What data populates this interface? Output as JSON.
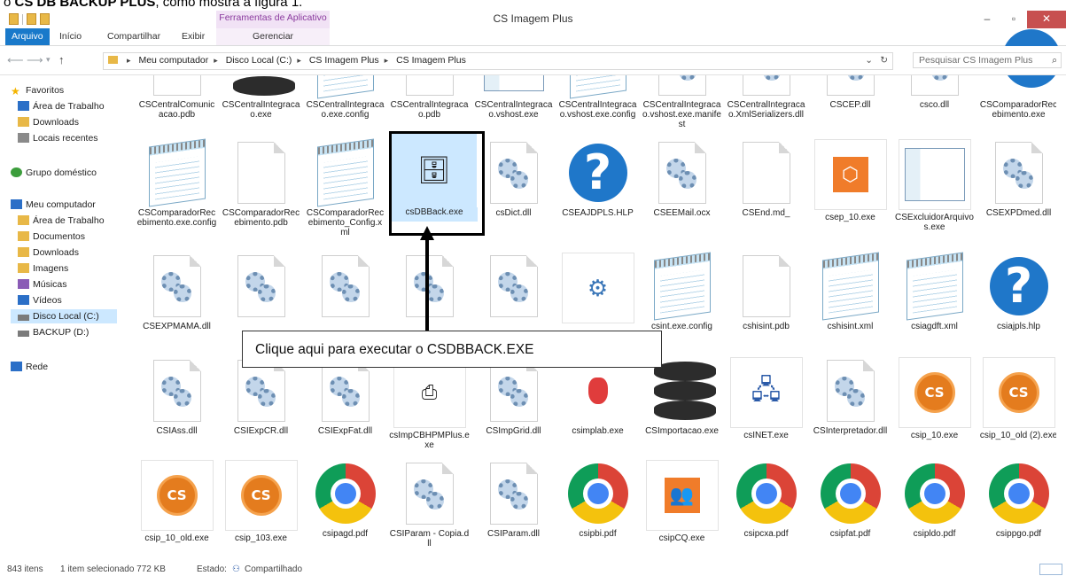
{
  "doc_text": {
    "prefix": "o ",
    "bold": "CS DB BACKUP PLUS",
    "suffix": ", como mostra a figura 1."
  },
  "window": {
    "title": "CS Imagem Plus",
    "contextual_tab": "Ferramentas de Aplicativo"
  },
  "ribbon": {
    "tabs": [
      "Arquivo",
      "Início",
      "Compartilhar",
      "Exibir",
      "Gerenciar"
    ]
  },
  "address": {
    "crumbs": [
      "Meu computador",
      "Disco Local (C:)",
      "CS Imagem Plus",
      "CS Imagem Plus"
    ],
    "search_placeholder": "Pesquisar CS Imagem Plus"
  },
  "sidebar": {
    "favorites": [
      "Favoritos",
      "Área de Trabalho",
      "Downloads",
      "Locais recentes"
    ],
    "homegroup": "Grupo doméstico",
    "computer": [
      "Meu computador",
      "Área de Trabalho",
      "Documentos",
      "Downloads",
      "Imagens",
      "Músicas",
      "Vídeos",
      "Disco Local (C:)",
      "BACKUP (D:)"
    ],
    "network": "Rede"
  },
  "files": {
    "row1": [
      "CSCentralComunicacao.pdb",
      "CSCentralIntegracao.exe",
      "CSCentralIntegracao.exe.config",
      "CSCentralIntegracao.pdb",
      "CSCentralIntegracao.vshost.exe",
      "CSCentralIntegracao.vshost.exe.config",
      "CSCentralIntegracao.vshost.exe.manifest",
      "CSCentralIntegracao.XmlSerializers.dll",
      "CSCEP.dll",
      "csco.dll",
      "CSComparadorRecebimento.exe"
    ],
    "row2": [
      "CSComparadorRecebimento.exe.config",
      "CSComparadorRecebimento.pdb",
      "CSComparadorRecebimento_Config.xml",
      "csDBBack.exe",
      "csDict.dll",
      "CSEAJDPLS.HLP",
      "CSEEMail.ocx",
      "CSEnd.md_",
      "csep_10.exe",
      "CSExcluidorArquivos.exe",
      "CSEXPDmed.dll"
    ],
    "row3": [
      "CSEXPMAMA.dll",
      "",
      "",
      "",
      "",
      "",
      "csint.exe.config",
      "cshisint.pdb",
      "cshisint.xml",
      "csiagdft.xml",
      "csiajpls.hlp"
    ],
    "row4": [
      "CSIAss.dll",
      "CSIExpCR.dll",
      "CSIExpFat.dll",
      "csImpCBHPMPlus.exe",
      "CSImpGrid.dll",
      "csimplab.exe",
      "CSImportacao.exe",
      "csINET.exe",
      "CSInterpretador.dll",
      "csip_10.exe",
      "csip_10_old (2).exe"
    ],
    "row5": [
      "csip_10_old.exe",
      "csip_103.exe",
      "csipagd.pdf",
      "CSIParam - Copia.dll",
      "CSIParam.dll",
      "csipbi.pdf",
      "csipCQ.exe",
      "csipcxa.pdf",
      "csipfat.pdf",
      "csipldo.pdf",
      "csippgo.pdf"
    ]
  },
  "callout": "Clique aqui para executar o CSDBBACK.EXE",
  "status": {
    "count": "843 itens",
    "selected": "1 item selecionado  772 KB",
    "state": "Estado:",
    "shared": "Compartilhado"
  }
}
